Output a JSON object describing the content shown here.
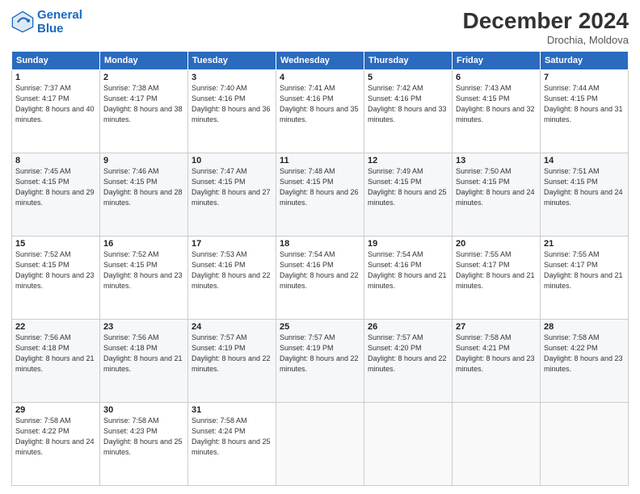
{
  "header": {
    "logo_line1": "General",
    "logo_line2": "Blue",
    "month": "December 2024",
    "location": "Drochia, Moldova"
  },
  "days_of_week": [
    "Sunday",
    "Monday",
    "Tuesday",
    "Wednesday",
    "Thursday",
    "Friday",
    "Saturday"
  ],
  "weeks": [
    [
      {
        "day": "1",
        "sunrise": "Sunrise: 7:37 AM",
        "sunset": "Sunset: 4:17 PM",
        "daylight": "Daylight: 8 hours and 40 minutes."
      },
      {
        "day": "2",
        "sunrise": "Sunrise: 7:38 AM",
        "sunset": "Sunset: 4:17 PM",
        "daylight": "Daylight: 8 hours and 38 minutes."
      },
      {
        "day": "3",
        "sunrise": "Sunrise: 7:40 AM",
        "sunset": "Sunset: 4:16 PM",
        "daylight": "Daylight: 8 hours and 36 minutes."
      },
      {
        "day": "4",
        "sunrise": "Sunrise: 7:41 AM",
        "sunset": "Sunset: 4:16 PM",
        "daylight": "Daylight: 8 hours and 35 minutes."
      },
      {
        "day": "5",
        "sunrise": "Sunrise: 7:42 AM",
        "sunset": "Sunset: 4:16 PM",
        "daylight": "Daylight: 8 hours and 33 minutes."
      },
      {
        "day": "6",
        "sunrise": "Sunrise: 7:43 AM",
        "sunset": "Sunset: 4:15 PM",
        "daylight": "Daylight: 8 hours and 32 minutes."
      },
      {
        "day": "7",
        "sunrise": "Sunrise: 7:44 AM",
        "sunset": "Sunset: 4:15 PM",
        "daylight": "Daylight: 8 hours and 31 minutes."
      }
    ],
    [
      {
        "day": "8",
        "sunrise": "Sunrise: 7:45 AM",
        "sunset": "Sunset: 4:15 PM",
        "daylight": "Daylight: 8 hours and 29 minutes."
      },
      {
        "day": "9",
        "sunrise": "Sunrise: 7:46 AM",
        "sunset": "Sunset: 4:15 PM",
        "daylight": "Daylight: 8 hours and 28 minutes."
      },
      {
        "day": "10",
        "sunrise": "Sunrise: 7:47 AM",
        "sunset": "Sunset: 4:15 PM",
        "daylight": "Daylight: 8 hours and 27 minutes."
      },
      {
        "day": "11",
        "sunrise": "Sunrise: 7:48 AM",
        "sunset": "Sunset: 4:15 PM",
        "daylight": "Daylight: 8 hours and 26 minutes."
      },
      {
        "day": "12",
        "sunrise": "Sunrise: 7:49 AM",
        "sunset": "Sunset: 4:15 PM",
        "daylight": "Daylight: 8 hours and 25 minutes."
      },
      {
        "day": "13",
        "sunrise": "Sunrise: 7:50 AM",
        "sunset": "Sunset: 4:15 PM",
        "daylight": "Daylight: 8 hours and 24 minutes."
      },
      {
        "day": "14",
        "sunrise": "Sunrise: 7:51 AM",
        "sunset": "Sunset: 4:15 PM",
        "daylight": "Daylight: 8 hours and 24 minutes."
      }
    ],
    [
      {
        "day": "15",
        "sunrise": "Sunrise: 7:52 AM",
        "sunset": "Sunset: 4:15 PM",
        "daylight": "Daylight: 8 hours and 23 minutes."
      },
      {
        "day": "16",
        "sunrise": "Sunrise: 7:52 AM",
        "sunset": "Sunset: 4:15 PM",
        "daylight": "Daylight: 8 hours and 23 minutes."
      },
      {
        "day": "17",
        "sunrise": "Sunrise: 7:53 AM",
        "sunset": "Sunset: 4:16 PM",
        "daylight": "Daylight: 8 hours and 22 minutes."
      },
      {
        "day": "18",
        "sunrise": "Sunrise: 7:54 AM",
        "sunset": "Sunset: 4:16 PM",
        "daylight": "Daylight: 8 hours and 22 minutes."
      },
      {
        "day": "19",
        "sunrise": "Sunrise: 7:54 AM",
        "sunset": "Sunset: 4:16 PM",
        "daylight": "Daylight: 8 hours and 21 minutes."
      },
      {
        "day": "20",
        "sunrise": "Sunrise: 7:55 AM",
        "sunset": "Sunset: 4:17 PM",
        "daylight": "Daylight: 8 hours and 21 minutes."
      },
      {
        "day": "21",
        "sunrise": "Sunrise: 7:55 AM",
        "sunset": "Sunset: 4:17 PM",
        "daylight": "Daylight: 8 hours and 21 minutes."
      }
    ],
    [
      {
        "day": "22",
        "sunrise": "Sunrise: 7:56 AM",
        "sunset": "Sunset: 4:18 PM",
        "daylight": "Daylight: 8 hours and 21 minutes."
      },
      {
        "day": "23",
        "sunrise": "Sunrise: 7:56 AM",
        "sunset": "Sunset: 4:18 PM",
        "daylight": "Daylight: 8 hours and 21 minutes."
      },
      {
        "day": "24",
        "sunrise": "Sunrise: 7:57 AM",
        "sunset": "Sunset: 4:19 PM",
        "daylight": "Daylight: 8 hours and 22 minutes."
      },
      {
        "day": "25",
        "sunrise": "Sunrise: 7:57 AM",
        "sunset": "Sunset: 4:19 PM",
        "daylight": "Daylight: 8 hours and 22 minutes."
      },
      {
        "day": "26",
        "sunrise": "Sunrise: 7:57 AM",
        "sunset": "Sunset: 4:20 PM",
        "daylight": "Daylight: 8 hours and 22 minutes."
      },
      {
        "day": "27",
        "sunrise": "Sunrise: 7:58 AM",
        "sunset": "Sunset: 4:21 PM",
        "daylight": "Daylight: 8 hours and 23 minutes."
      },
      {
        "day": "28",
        "sunrise": "Sunrise: 7:58 AM",
        "sunset": "Sunset: 4:22 PM",
        "daylight": "Daylight: 8 hours and 23 minutes."
      }
    ],
    [
      {
        "day": "29",
        "sunrise": "Sunrise: 7:58 AM",
        "sunset": "Sunset: 4:22 PM",
        "daylight": "Daylight: 8 hours and 24 minutes."
      },
      {
        "day": "30",
        "sunrise": "Sunrise: 7:58 AM",
        "sunset": "Sunset: 4:23 PM",
        "daylight": "Daylight: 8 hours and 25 minutes."
      },
      {
        "day": "31",
        "sunrise": "Sunrise: 7:58 AM",
        "sunset": "Sunset: 4:24 PM",
        "daylight": "Daylight: 8 hours and 25 minutes."
      },
      null,
      null,
      null,
      null
    ]
  ]
}
